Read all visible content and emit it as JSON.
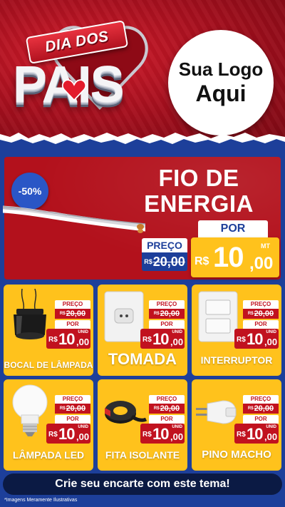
{
  "header": {
    "ribbon_text": "DIA DOS",
    "title_text": "PAIS",
    "logo_line1": "Sua Logo",
    "logo_line2": "Aqui"
  },
  "main_offer": {
    "discount": "-50%",
    "title_line1": "FIO DE",
    "title_line2": "ENERGIA",
    "por_label": "POR",
    "preco_label": "PREÇO",
    "old_currency": "R$",
    "old_price": "20,00",
    "new_currency": "R$",
    "new_integer": "10",
    "new_decimal": ",00",
    "unit": "MT"
  },
  "products": [
    {
      "name": "BOCAL DE LÂMPADA",
      "icon": "lamp-socket-icon",
      "preco_label": "PREÇO",
      "old_currency": "R$",
      "old_price": "20,00",
      "por_label": "POR",
      "new_currency": "R$",
      "new_integer": "10",
      "new_decimal": ",00",
      "unit": "UNID"
    },
    {
      "name": "TOMADA",
      "icon": "outlet-icon",
      "preco_label": "PREÇO",
      "old_currency": "R$",
      "old_price": "20,00",
      "por_label": "POR",
      "new_currency": "R$",
      "new_integer": "10",
      "new_decimal": ",00",
      "unit": "UNID"
    },
    {
      "name": "INTERRUPTOR",
      "icon": "switch-icon",
      "preco_label": "PREÇO",
      "old_currency": "R$",
      "old_price": "20,00",
      "por_label": "POR",
      "new_currency": "R$",
      "new_integer": "10",
      "new_decimal": ",00",
      "unit": "UNID"
    },
    {
      "name": "LÂMPADA LED",
      "icon": "led-bulb-icon",
      "preco_label": "PREÇO",
      "old_currency": "R$",
      "old_price": "20,00",
      "por_label": "POR",
      "new_currency": "R$",
      "new_integer": "10",
      "new_decimal": ",00",
      "unit": "UNID"
    },
    {
      "name": "FITA ISOLANTE",
      "icon": "tape-icon",
      "preco_label": "PREÇO",
      "old_currency": "R$",
      "old_price": "20,00",
      "por_label": "POR",
      "new_currency": "R$",
      "new_integer": "10",
      "new_decimal": ",00",
      "unit": "UNID"
    },
    {
      "name": "PINO MACHO",
      "icon": "plug-icon",
      "preco_label": "PREÇO",
      "old_currency": "R$",
      "old_price": "20,00",
      "por_label": "POR",
      "new_currency": "R$",
      "new_integer": "10",
      "new_decimal": ",00",
      "unit": "UNID"
    }
  ],
  "footer": {
    "cta": "Crie seu encarte com este tema!",
    "disclaimer": "*Imagens Meramente Ilustrativas"
  },
  "colors": {
    "header_red": "#b3111c",
    "background_blue": "#1d3f9a",
    "card_yellow": "#ffc21c",
    "price_red": "#c1121f",
    "cta_navy": "#0b1a44"
  }
}
